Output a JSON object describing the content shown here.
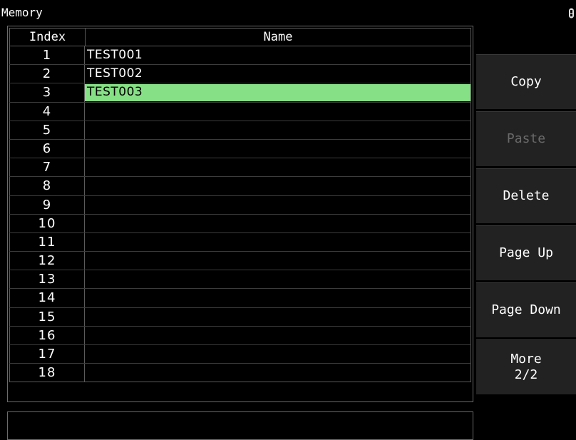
{
  "app": {
    "title": "Memory"
  },
  "table": {
    "headers": {
      "index": "Index",
      "name": "Name"
    },
    "rows": [
      {
        "index": "1",
        "name": "TEST001"
      },
      {
        "index": "2",
        "name": "TEST002"
      },
      {
        "index": "3",
        "name": "TEST003",
        "selected": true
      },
      {
        "index": "4",
        "name": ""
      },
      {
        "index": "5",
        "name": ""
      },
      {
        "index": "6",
        "name": ""
      },
      {
        "index": "7",
        "name": ""
      },
      {
        "index": "8",
        "name": ""
      },
      {
        "index": "9",
        "name": ""
      },
      {
        "index": "10",
        "name": ""
      },
      {
        "index": "11",
        "name": ""
      },
      {
        "index": "12",
        "name": ""
      },
      {
        "index": "13",
        "name": ""
      },
      {
        "index": "14",
        "name": ""
      },
      {
        "index": "15",
        "name": ""
      },
      {
        "index": "16",
        "name": ""
      },
      {
        "index": "17",
        "name": ""
      },
      {
        "index": "18",
        "name": ""
      }
    ]
  },
  "softkeys": {
    "copy": "Copy",
    "paste": "Paste",
    "delete": "Delete",
    "page_up": "Page Up",
    "page_down": "Page Down",
    "more": "More\n2/2"
  },
  "colors": {
    "selection": "#86e085",
    "background": "#000000",
    "button": "#222222",
    "disabled_text": "#6a6a6a"
  },
  "icons": {
    "status": "usb-icon"
  }
}
